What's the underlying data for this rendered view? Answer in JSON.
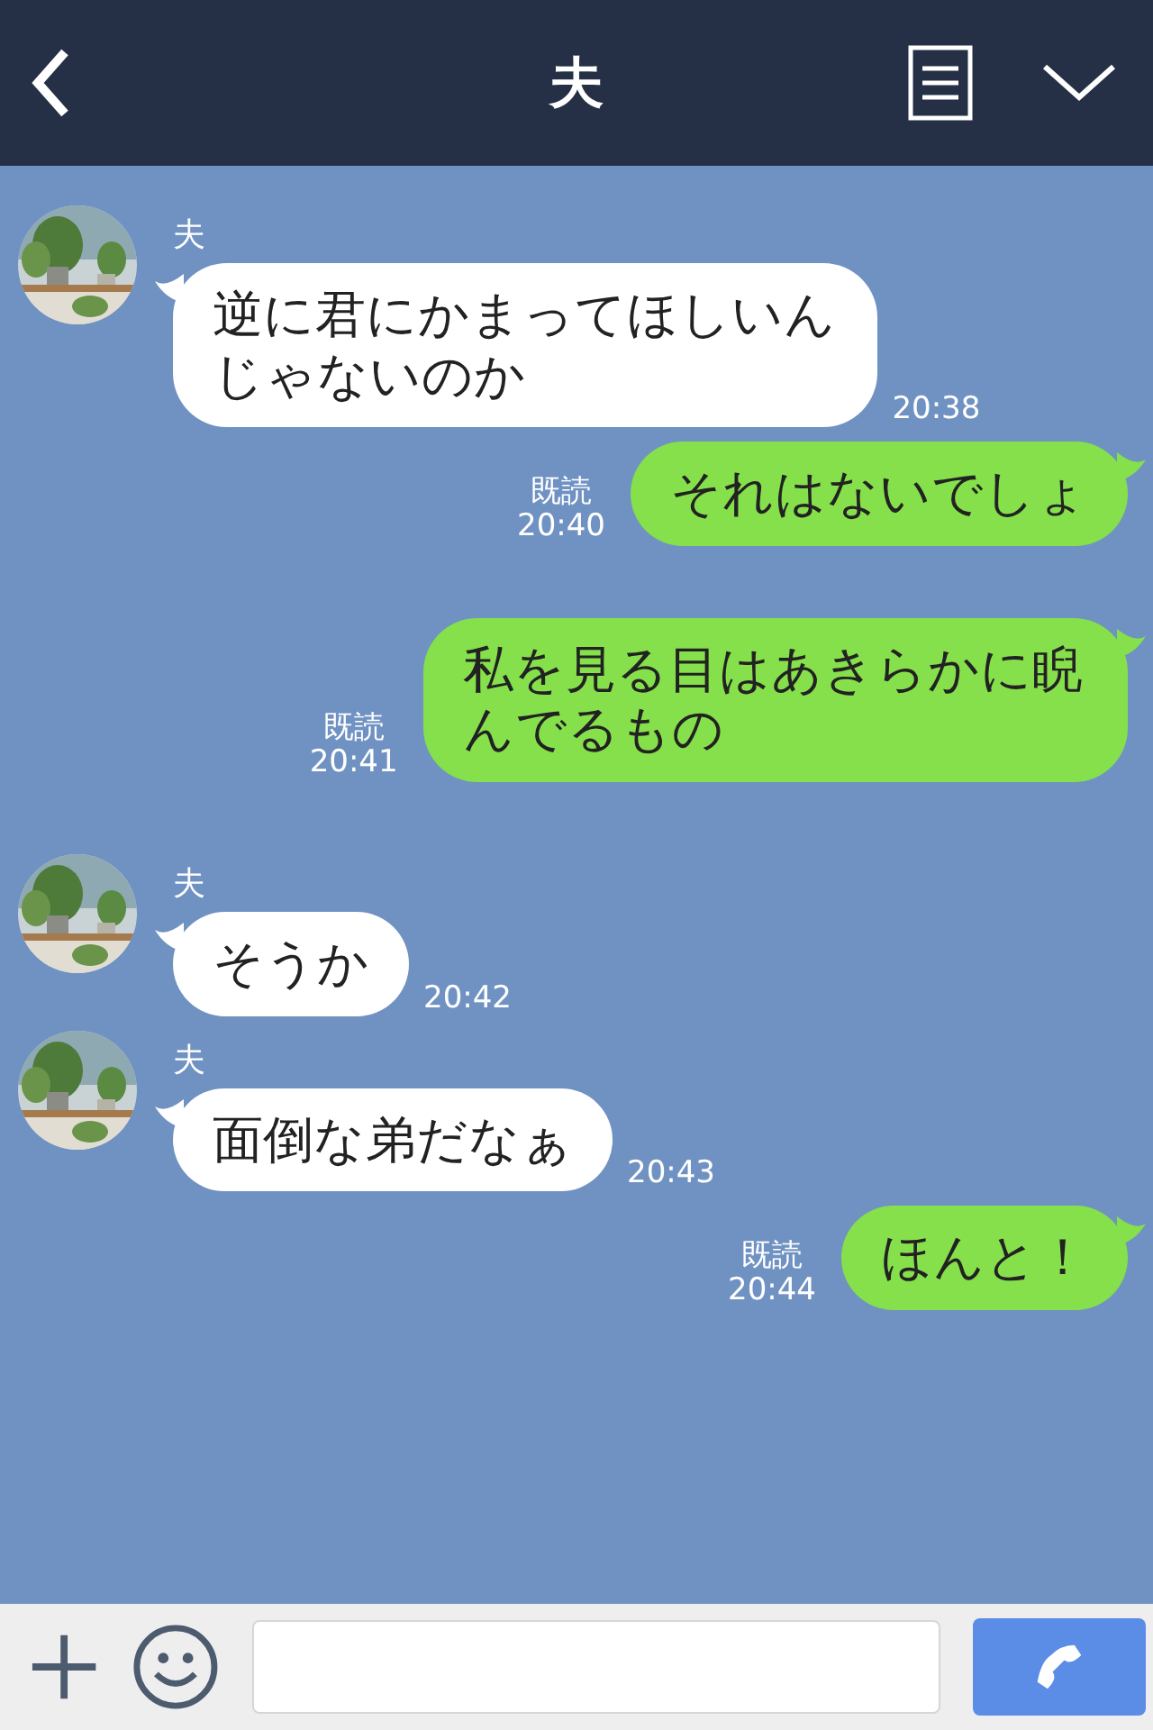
{
  "header": {
    "title": "夫"
  },
  "messages": [
    {
      "kind": "incoming",
      "sender": "夫",
      "text": "逆に君にかまってほしいんじゃないのか",
      "time": "20:38"
    },
    {
      "kind": "outgoing",
      "read": "既読",
      "text": "それはないでしょ",
      "time": "20:40"
    },
    {
      "kind": "outgoing",
      "read": "既読",
      "text": "私を見る目はあきらかに睨んでるもの",
      "time": "20:41"
    },
    {
      "kind": "incoming",
      "sender": "夫",
      "text": "そうか",
      "time": "20:42"
    },
    {
      "kind": "incoming",
      "sender": "夫",
      "text": "面倒な弟だなぁ",
      "time": "20:43"
    },
    {
      "kind": "outgoing",
      "read": "既読",
      "text": "ほんと！",
      "time": "20:44"
    }
  ]
}
